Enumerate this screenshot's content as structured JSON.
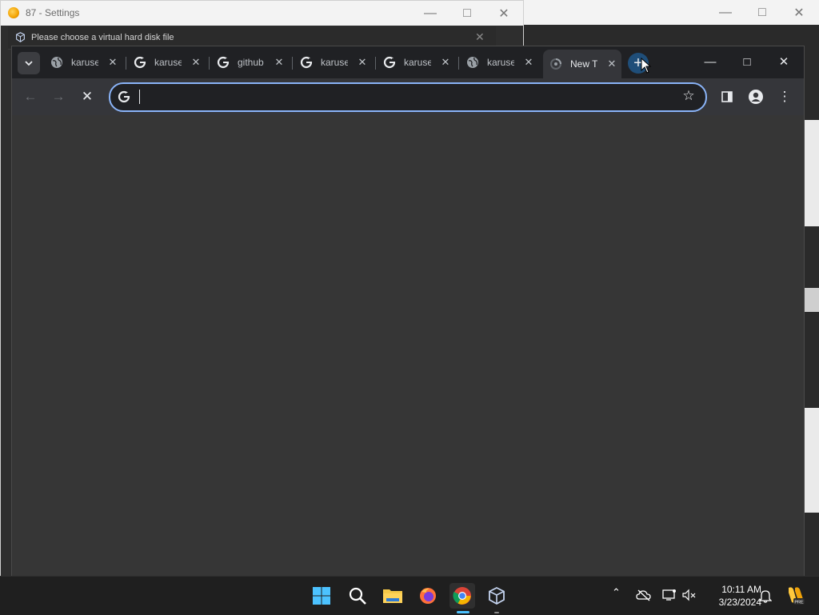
{
  "settings_window": {
    "title": "87 - Settings",
    "dialog_title": "Please choose a virtual hard disk file"
  },
  "chrome": {
    "tabs": [
      {
        "title": "karuse",
        "icon": "globe-icon"
      },
      {
        "title": "karuse",
        "icon": "google-icon"
      },
      {
        "title": "github",
        "icon": "google-icon"
      },
      {
        "title": "karuse",
        "icon": "google-icon"
      },
      {
        "title": "karuse",
        "icon": "google-icon"
      },
      {
        "title": "karuse",
        "icon": "globe-icon"
      },
      {
        "title": "New T",
        "icon": "loading-icon",
        "active": true
      }
    ],
    "omnibox": {
      "value": "",
      "placeholder": ""
    },
    "accent": "#8ab4f8"
  },
  "taskbar": {
    "apps": [
      "start-icon",
      "search-icon",
      "file-explorer-icon",
      "firefox-icon",
      "chrome-icon",
      "virtualbox-icon"
    ],
    "clock_time": "10:11 AM",
    "clock_date": "3/23/2024"
  }
}
